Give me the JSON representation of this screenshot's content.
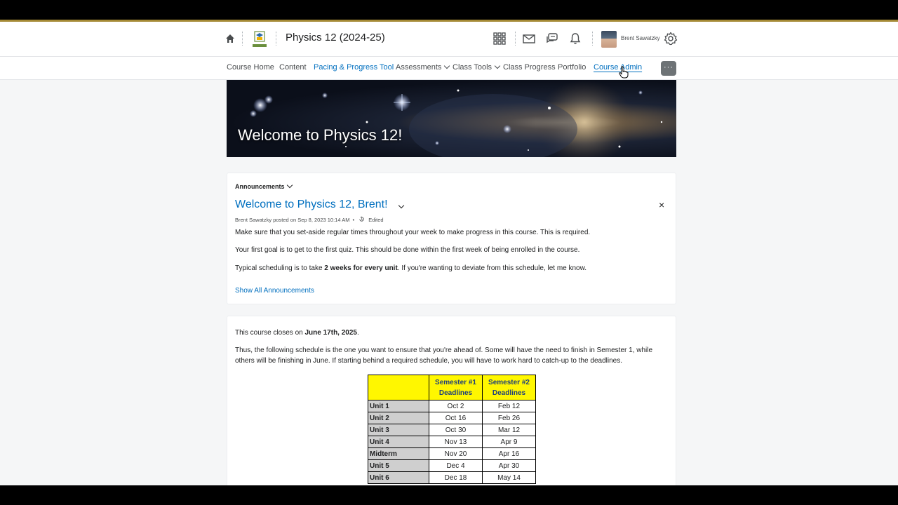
{
  "header": {
    "course_title": "Physics 12 (2024-25)",
    "user_name": "Brent Sawatzky"
  },
  "nav": {
    "items": [
      {
        "label": "Course Home"
      },
      {
        "label": "Content"
      },
      {
        "label": "Pacing & Progress Tool"
      },
      {
        "label": "Assessments"
      },
      {
        "label": "Class Tools"
      },
      {
        "label": "Class Progress"
      },
      {
        "label": "Portfolio"
      },
      {
        "label": "Course Admin"
      }
    ],
    "more_label": "···"
  },
  "banner": {
    "title": "Welcome to Physics 12!"
  },
  "announcements": {
    "label": "Announcements",
    "title": "Welcome to Physics 12, Brent!",
    "meta": "Brent Sawatzky posted on Sep 8, 2023 10:14 AM",
    "edited": "Edited",
    "p1": "Make sure that you set-aside regular times throughout your week to make progress in this course.  This is required.",
    "p2": "Your first goal is to get to the first quiz.   This should be done within the first week of being enrolled in the course.",
    "p3_pre": "Typical scheduling is to take ",
    "p3_bold": "2 weeks for every unit",
    "p3_post": ".   If you're wanting to deviate from this schedule, let me know.",
    "show_all": "Show All Announcements",
    "close": "×"
  },
  "schedule": {
    "close_pre": "This course closes on ",
    "close_bold": "June 17th, 2025",
    "close_post": ".",
    "para_line1": "Thus, the following schedule is the one you want to ensure that you're ahead of.    Some will have the need to finish in Semester 1, while",
    "para_line2": "others will be finishing in June.    If starting behind a required schedule, you  will have to work hard to catch-up to the deadlines.",
    "headers": [
      "Semester #1 Deadlines",
      "Semester #2 Deadlines"
    ],
    "rows": [
      {
        "unit": "Unit 1",
        "s1": "Oct 2",
        "s2": "Feb 12"
      },
      {
        "unit": "Unit 2",
        "s1": "Oct 16",
        "s2": "Feb 26"
      },
      {
        "unit": "Unit 3",
        "s1": "Oct 30",
        "s2": "Mar 12"
      },
      {
        "unit": "Unit 4",
        "s1": "Nov 13",
        "s2": "Apr 9"
      },
      {
        "unit": "Midterm",
        "s1": "Nov 20",
        "s2": "Apr 16"
      },
      {
        "unit": "Unit 5",
        "s1": "Dec 4",
        "s2": "Apr 30"
      },
      {
        "unit": "Unit 6",
        "s1": "Dec 18",
        "s2": "May 14"
      }
    ]
  }
}
